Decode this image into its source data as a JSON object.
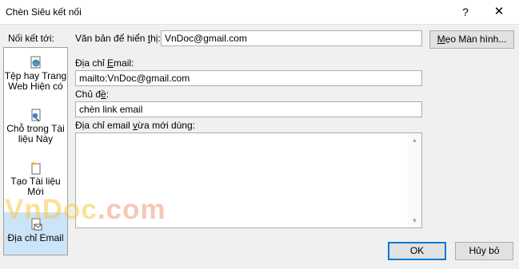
{
  "window": {
    "title": "Chèn Siêu kết nối",
    "help_glyph": "?",
    "close_glyph": "✕"
  },
  "nav": {
    "label": "Nối kết tới:",
    "items": [
      {
        "line1": "Tệp hay Trang",
        "line2": "Web Hiện có",
        "icon": "web-page-icon"
      },
      {
        "line1": "Chỗ trong Tài",
        "line2": "liệu Này",
        "icon": "place-in-document-icon"
      },
      {
        "line1": "Tạo Tài liệu",
        "line2": "Mới",
        "icon": "new-document-icon"
      },
      {
        "line1": "Địa chỉ Email",
        "line2": "",
        "icon": "email-icon",
        "selected": true
      }
    ]
  },
  "form": {
    "display_text_label_pre": "Văn bản để hiển ",
    "display_text_label_u": "t",
    "display_text_label_post": "hị:",
    "display_text_value": "VnDoc@gmail.com",
    "screentip_button_pre": "",
    "screentip_button_u": "M",
    "screentip_button_post": "ẹo Màn hình...",
    "email_label_pre": "Địa chỉ ",
    "email_label_u": "E",
    "email_label_post": "mail:",
    "email_value": "mailto:VnDoc@gmail.com",
    "subject_label_pre": "Chủ đ",
    "subject_label_u": "ề",
    "subject_label_post": ":",
    "subject_value": "chèn link email",
    "recent_label_pre": "Địa chỉ email ",
    "recent_label_u": "v",
    "recent_label_post": "ừa mới dùng:"
  },
  "buttons": {
    "ok": "OK",
    "cancel": "Hủy bỏ"
  },
  "watermark": {
    "part1": "VnDoc",
    "part2": ".com"
  },
  "colors": {
    "selected_bg": "#cce4f7",
    "default_border": "#0078d7"
  }
}
